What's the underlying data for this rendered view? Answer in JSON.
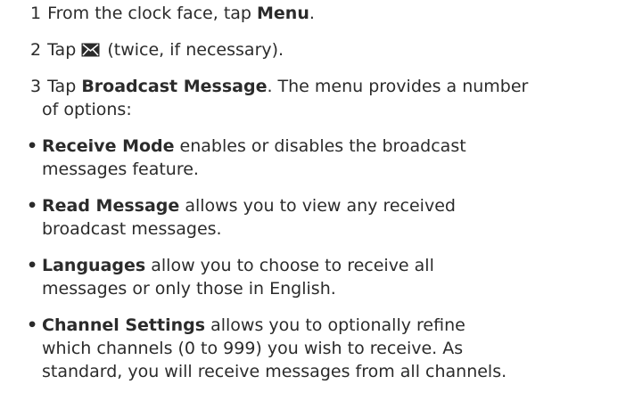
{
  "steps": [
    {
      "number": "1",
      "before": "From the clock face, tap ",
      "bold": "Menu",
      "after": "."
    },
    {
      "number": "2",
      "before": "Tap ",
      "icon": "envelope-icon",
      "after": " (twice, if necessary)."
    },
    {
      "number": "3",
      "before": "Tap ",
      "bold": "Broadcast Message",
      "after": ". The menu provides a number",
      "cont": "of options:"
    }
  ],
  "options": [
    {
      "title": "Receive Mode",
      "line1": " enables or disables the broadcast",
      "line2": "messages feature."
    },
    {
      "title": "Read Message",
      "line1": " allows you to view any received",
      "line2": "broadcast messages."
    },
    {
      "title": "Languages",
      "line1": " allow you to choose to receive all",
      "line2": "messages or only those in English."
    },
    {
      "title": "Channel Settings",
      "line1": " allows you to optionally refine",
      "line2": "which channels (0 to 999) you wish to receive. As",
      "line3": "standard, you will receive messages from all channels."
    }
  ],
  "bullet_glyph": "•"
}
